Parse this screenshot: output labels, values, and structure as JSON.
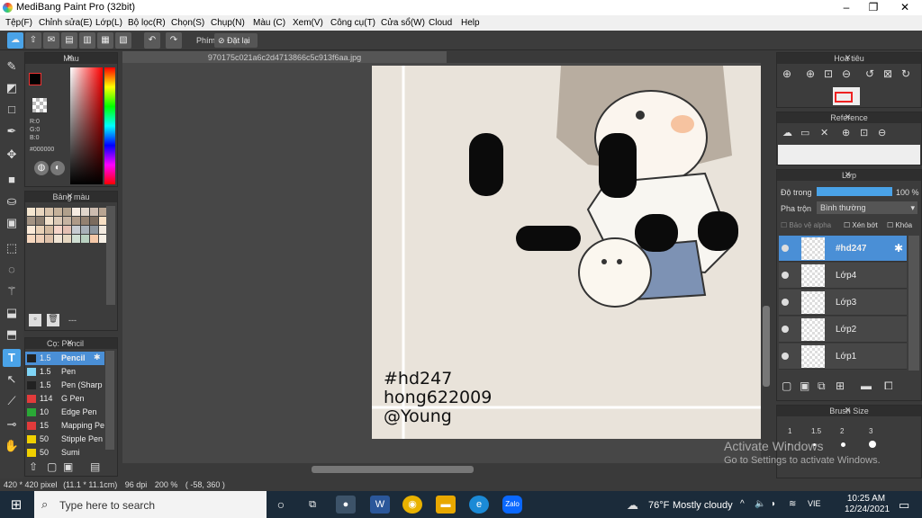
{
  "app": {
    "title": "MediBang Paint Pro (32bit)"
  },
  "menu": [
    "Tệp(F)",
    "Chỉnh sửa(E)",
    "Lớp(L)",
    "Bộ lọc(R)",
    "Chọn(S)",
    "Chụp(N)",
    "Màu (C)",
    "Xem(V)",
    "Công cụ(T)",
    "Cửa sổ(W)",
    "Cloud",
    "Help"
  ],
  "toolbar": {
    "key_label": "Phím",
    "reset_label": "Đặt lại"
  },
  "panels": {
    "color": {
      "title": "Màu",
      "r": "R:0",
      "g": "G:0",
      "b": "B:0",
      "hex": "#000000"
    },
    "palette": {
      "title": "Bảng màu",
      "footer": "---"
    },
    "brush": {
      "title": "Cọ: Pencil",
      "items": [
        {
          "size": "1.5",
          "name": "Pencil",
          "color": "#222222"
        },
        {
          "size": "1.5",
          "name": "Pen",
          "color": "#7fd4f6"
        },
        {
          "size": "1.5",
          "name": "Pen (Sharp",
          "color": "#222222"
        },
        {
          "size": "114",
          "name": "G Pen",
          "color": "#e23b3b"
        },
        {
          "size": "10",
          "name": "Edge Pen",
          "color": "#2aa836"
        },
        {
          "size": "15",
          "name": "Mapping Pe",
          "color": "#e23b3b"
        },
        {
          "size": "50",
          "name": "Stipple Pen",
          "color": "#f0d000"
        },
        {
          "size": "50",
          "name": "Sumi",
          "color": "#f0d000"
        }
      ]
    },
    "navigator": {
      "title": "Hoa tiêu"
    },
    "reference": {
      "title": "Reference"
    },
    "layers": {
      "title": "Lớp",
      "opacity_label": "Độ trong",
      "opacity_value": "100 %",
      "opacity": 1.0,
      "blend_label": "Pha trộn",
      "blend_value": "Bình thường",
      "protect_alpha": "Bảo vệ alpha",
      "clipping": "Xén bớt",
      "lock": "Khóa",
      "items": [
        {
          "name": "#hd247",
          "selected": true
        },
        {
          "name": "Lớp4",
          "selected": false
        },
        {
          "name": "Lớp3",
          "selected": false
        },
        {
          "name": "Lớp2",
          "selected": false
        },
        {
          "name": "Lớp1",
          "selected": false
        }
      ]
    },
    "brushsize": {
      "title": "Brush Size",
      "values": [
        "1",
        "1.5",
        "2",
        "3"
      ]
    }
  },
  "document": {
    "filename": "970175c021a6c2d4713866c5c913f6aa.jpg",
    "watermark_lines": [
      "#hd247",
      "hong622009",
      "@Young"
    ]
  },
  "status": {
    "size": "420 * 420 pixel",
    "cm": "(11.1 * 11.1cm)",
    "dpi": "96 dpi",
    "zoom": "200 %",
    "coords": "( -58, 360 )"
  },
  "activation": {
    "line1": "Activate Windows",
    "line2": "Go to Settings to activate Windows."
  },
  "taskbar": {
    "search_placeholder": "Type here to search",
    "weather_temp": "76°F",
    "weather_desc": "Mostly cloudy",
    "lang": "VIE",
    "time": "10:25 AM",
    "date": "12/24/2021"
  },
  "colors": {
    "accent": "#4aa3e8",
    "selected_layer": "#4a8fd6"
  }
}
